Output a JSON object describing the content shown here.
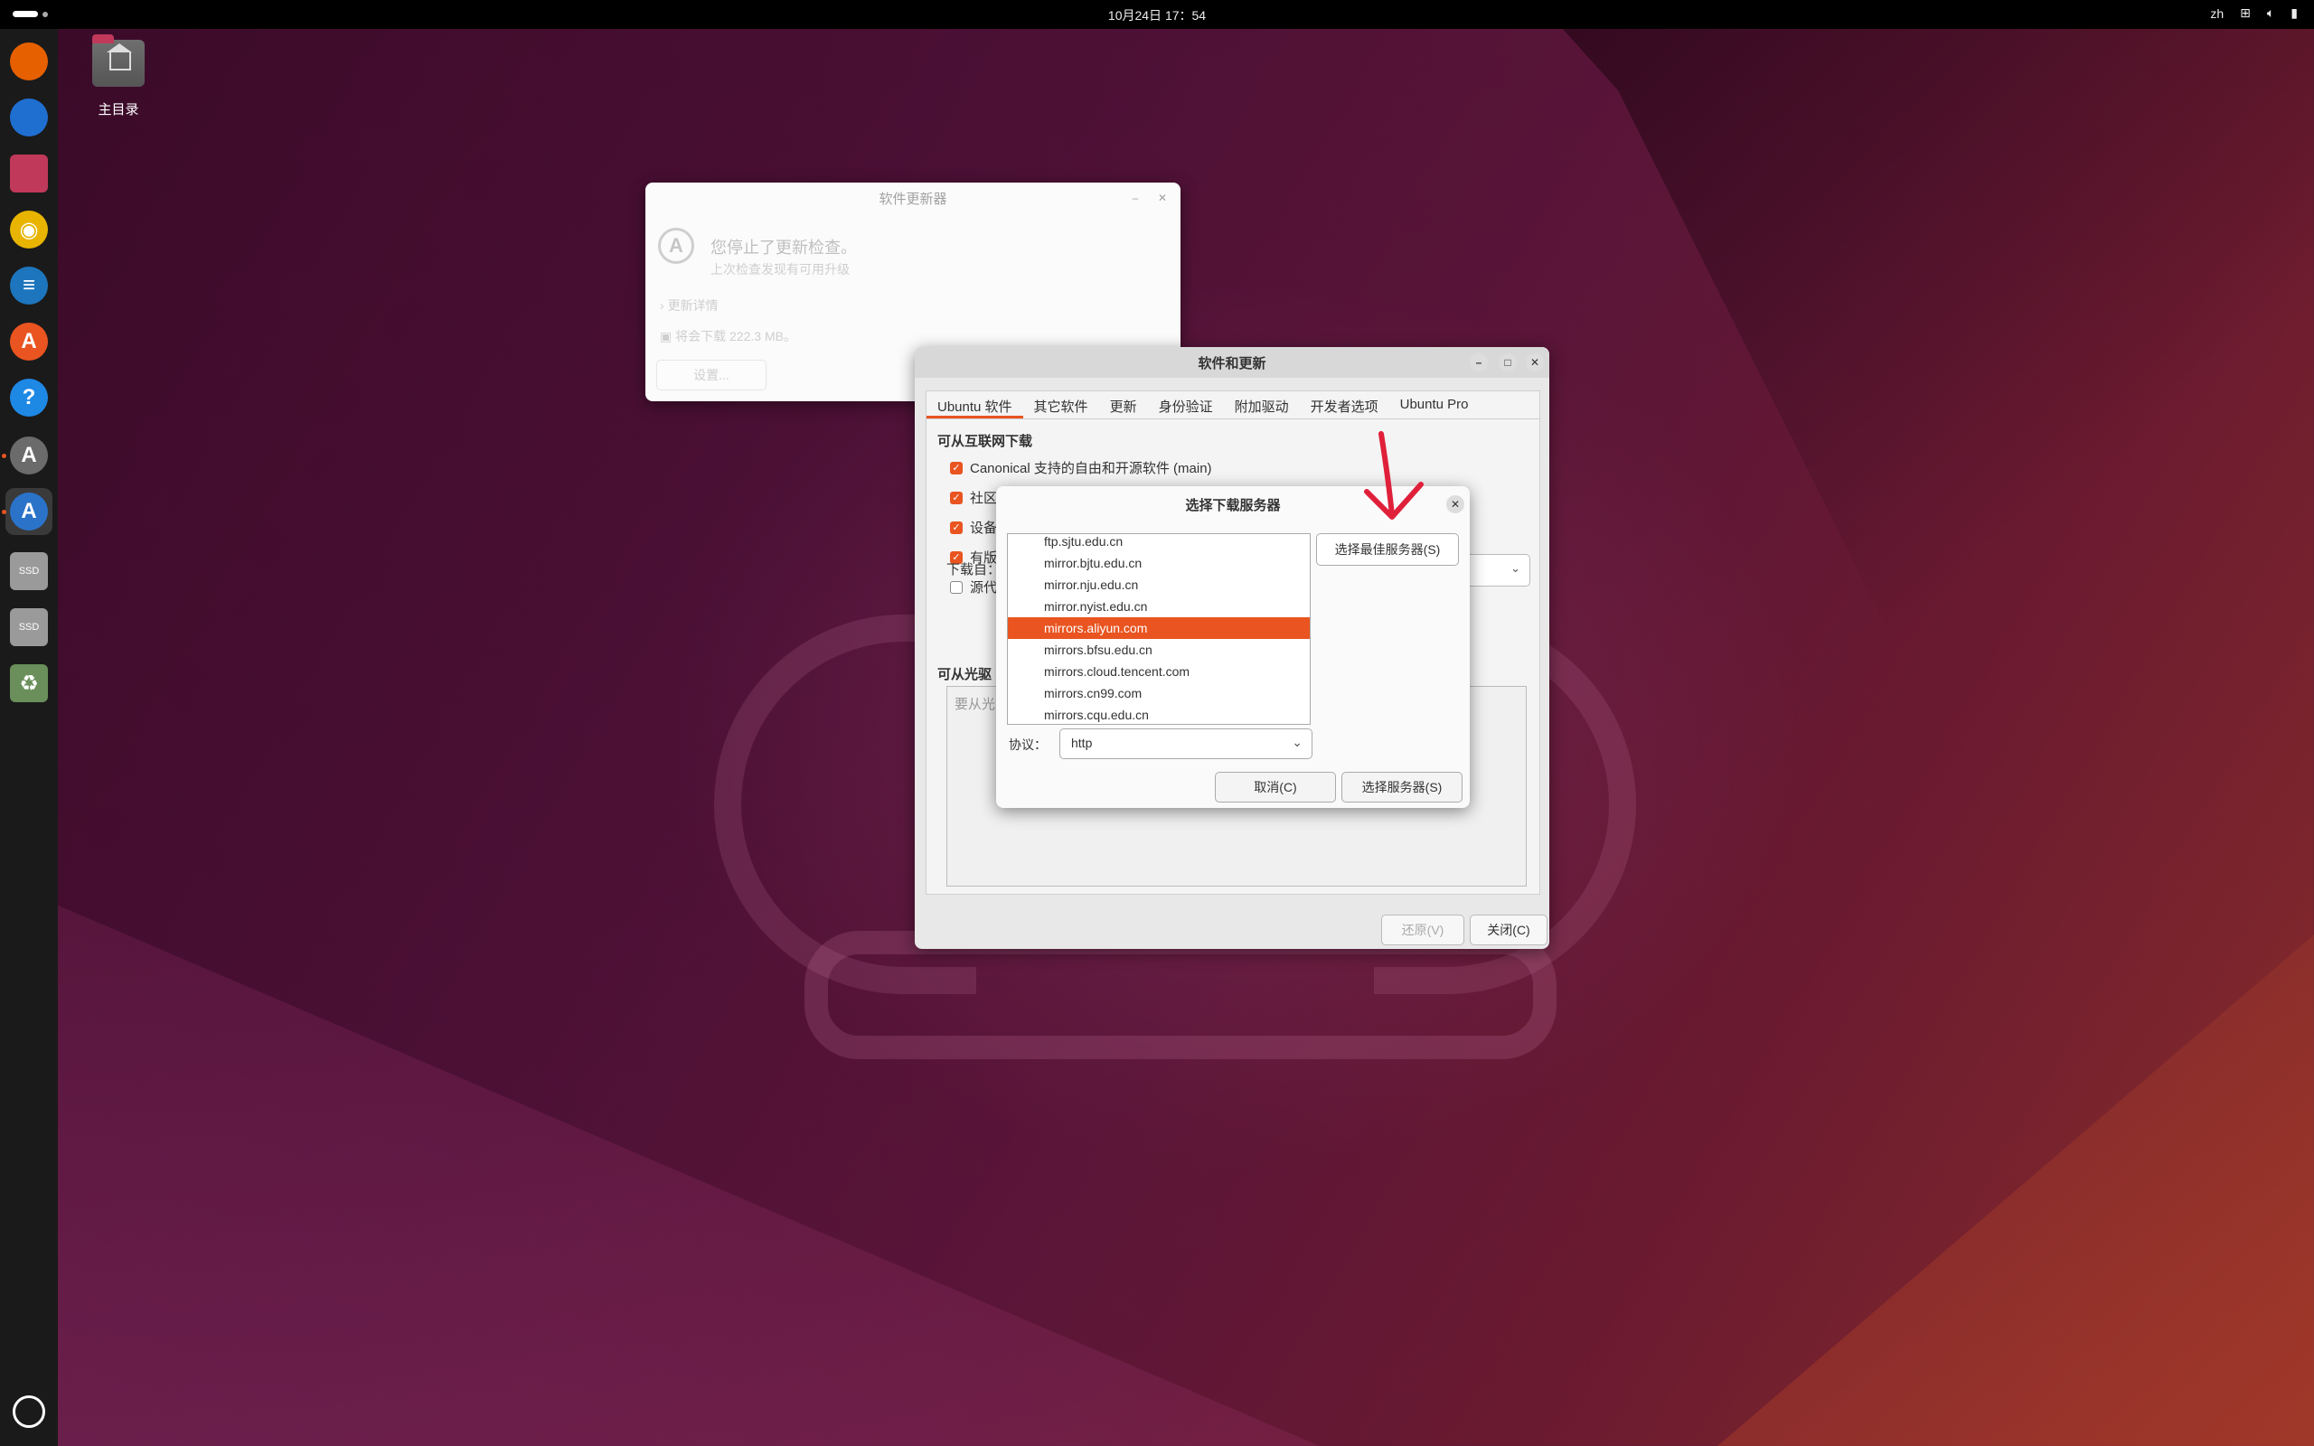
{
  "topbar": {
    "clock": "10月24日  17：54",
    "lang": "zh",
    "network_icon": "network-icon",
    "volume_icon": "volume-icon",
    "battery_icon": "battery-icon"
  },
  "dock": {
    "items": [
      {
        "name": "firefox-icon",
        "glyph": "",
        "color": "#e66000"
      },
      {
        "name": "thunderbird-icon",
        "glyph": "",
        "color": "#1f6fd1"
      },
      {
        "name": "files-icon",
        "glyph": "",
        "color": "#c0395a"
      },
      {
        "name": "rhythmbox-icon",
        "glyph": "◉",
        "color": "#e8b400"
      },
      {
        "name": "libreoffice-writer-icon",
        "glyph": "≡",
        "color": "#1d76bd"
      },
      {
        "name": "app-center-icon",
        "glyph": "A",
        "color": "#e95420"
      },
      {
        "name": "help-icon",
        "glyph": "?",
        "color": "#1e88e5"
      },
      {
        "name": "software-updater-icon",
        "glyph": "A",
        "color": "#6b6b6b"
      },
      {
        "name": "software-properties-icon",
        "glyph": "A",
        "color": "#2a73c9"
      },
      {
        "name": "ssd-drive-icon",
        "glyph": "SSD",
        "color": "#9a9a9a"
      },
      {
        "name": "ssd-drive-2-icon",
        "glyph": "SSD",
        "color": "#9a9a9a"
      },
      {
        "name": "trash-icon",
        "glyph": "♻",
        "color": "#6a8f5a"
      }
    ],
    "apps_grid_icon": "ubuntu-apps-icon"
  },
  "desktop": {
    "home_label": "主目录"
  },
  "updater": {
    "title": "软件更新器",
    "heading": "您停止了更新检查。",
    "subheading": "上次检查发现有可用升级",
    "details": "更新详情",
    "download": "将会下载 222.3 MB。",
    "settings_button": "设置..."
  },
  "software_updates": {
    "title": "软件和更新",
    "tabs": [
      "Ubuntu 软件",
      "其它软件",
      "更新",
      "身份验证",
      "附加驱动",
      "开发者选项",
      "Ubuntu Pro"
    ],
    "internet_section": "可从互联网下载",
    "checkboxes": [
      {
        "label": "Canonical 支持的自由和开源软件 (main)",
        "checked": true
      },
      {
        "label": "社区",
        "checked": true
      },
      {
        "label": "设备",
        "checked": true
      },
      {
        "label": "有版",
        "checked": true
      },
      {
        "label": "源代",
        "checked": false
      }
    ],
    "download_from": "下载自：",
    "cdrom_section": "可从光驱",
    "cdrom_placeholder": "要从光",
    "revert_button": "还原(V)",
    "close_button": "关闭(C)"
  },
  "server_dialog": {
    "title": "选择下载服务器",
    "servers": [
      "ftp.sjtu.edu.cn",
      "mirror.bjtu.edu.cn",
      "mirror.nju.edu.cn",
      "mirror.nyist.edu.cn",
      "mirrors.aliyun.com",
      "mirrors.bfsu.edu.cn",
      "mirrors.cloud.tencent.com",
      "mirrors.cn99.com",
      "mirrors.cqu.edu.cn"
    ],
    "selected_server": "mirrors.aliyun.com",
    "best_server_button": "选择最佳服务器(S)",
    "protocol_label": "协议：",
    "protocol_value": "http",
    "cancel_button": "取消(C)",
    "choose_button": "选择服务器(S)"
  },
  "colors": {
    "accent": "#e95420",
    "annotation_arrow": "#e0203a"
  }
}
